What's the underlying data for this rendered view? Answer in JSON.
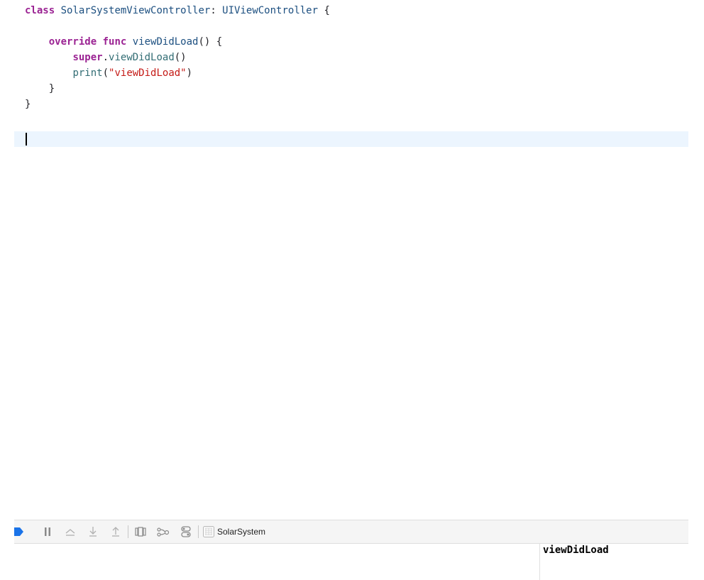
{
  "editor": {
    "lines": [
      [
        {
          "t": "class",
          "c": "kw"
        },
        {
          "t": " ",
          "c": "plain"
        },
        {
          "t": "SolarSystemViewController",
          "c": "typ"
        },
        {
          "t": ": ",
          "c": "plain"
        },
        {
          "t": "UIViewController",
          "c": "typ"
        },
        {
          "t": " {",
          "c": "plain"
        }
      ],
      [],
      [
        {
          "t": "    ",
          "c": "plain"
        },
        {
          "t": "override",
          "c": "kw"
        },
        {
          "t": " ",
          "c": "plain"
        },
        {
          "t": "func",
          "c": "kw"
        },
        {
          "t": " ",
          "c": "plain"
        },
        {
          "t": "viewDidLoad",
          "c": "typ"
        },
        {
          "t": "() {",
          "c": "plain"
        }
      ],
      [
        {
          "t": "        ",
          "c": "plain"
        },
        {
          "t": "super",
          "c": "kw"
        },
        {
          "t": ".",
          "c": "plain"
        },
        {
          "t": "viewDidLoad",
          "c": "fn"
        },
        {
          "t": "()",
          "c": "plain"
        }
      ],
      [
        {
          "t": "        ",
          "c": "plain"
        },
        {
          "t": "print",
          "c": "fn"
        },
        {
          "t": "(",
          "c": "plain"
        },
        {
          "t": "\"viewDidLoad\"",
          "c": "str"
        },
        {
          "t": ")",
          "c": "plain"
        }
      ],
      [
        {
          "t": "    }",
          "c": "plain"
        }
      ],
      [
        {
          "t": "}",
          "c": "plain"
        }
      ]
    ]
  },
  "debug_bar": {
    "buttons": [
      "breakpoints-toggle-icon",
      "pause-icon",
      "step-over-icon",
      "step-into-icon",
      "step-out-icon",
      "view-hierarchy-icon",
      "memory-graph-icon",
      "environment-overrides-icon"
    ],
    "scheme_name": "SolarSystem",
    "accent_color": "#1a73e8"
  },
  "console": {
    "output": "viewDidLoad"
  }
}
